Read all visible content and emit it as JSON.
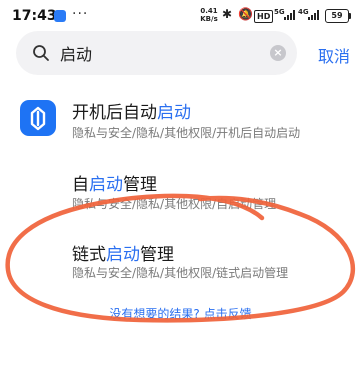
{
  "status_bar": {
    "time": "17:43",
    "more": "···",
    "net_speed_value": "0.41",
    "net_speed_unit": "KB/s",
    "hd_label": "HD",
    "network_1": "5G",
    "network_2": "4G",
    "battery": "59"
  },
  "search": {
    "query": "启动",
    "cancel_label": "取消"
  },
  "results": [
    {
      "title_prefix": "开机后自动",
      "title_highlight": "启动",
      "title_suffix": "",
      "path": "隐私与安全/隐私/其他权限/开机后自动启动"
    },
    {
      "title_prefix": "自",
      "title_highlight": "启动",
      "title_suffix": "管理",
      "path": "隐私与安全/隐私/其他权限/自启动管理"
    },
    {
      "title_prefix": "链式",
      "title_highlight": "启动",
      "title_suffix": "管理",
      "path": "隐私与安全/隐私/其他权限/链式启动管理"
    }
  ],
  "feedback_link": "没有想要的结果? 点击反馈",
  "colors": {
    "accent": "#2a6ff0",
    "app_icon": "#1e73f4",
    "annotation": "#f0623a"
  }
}
